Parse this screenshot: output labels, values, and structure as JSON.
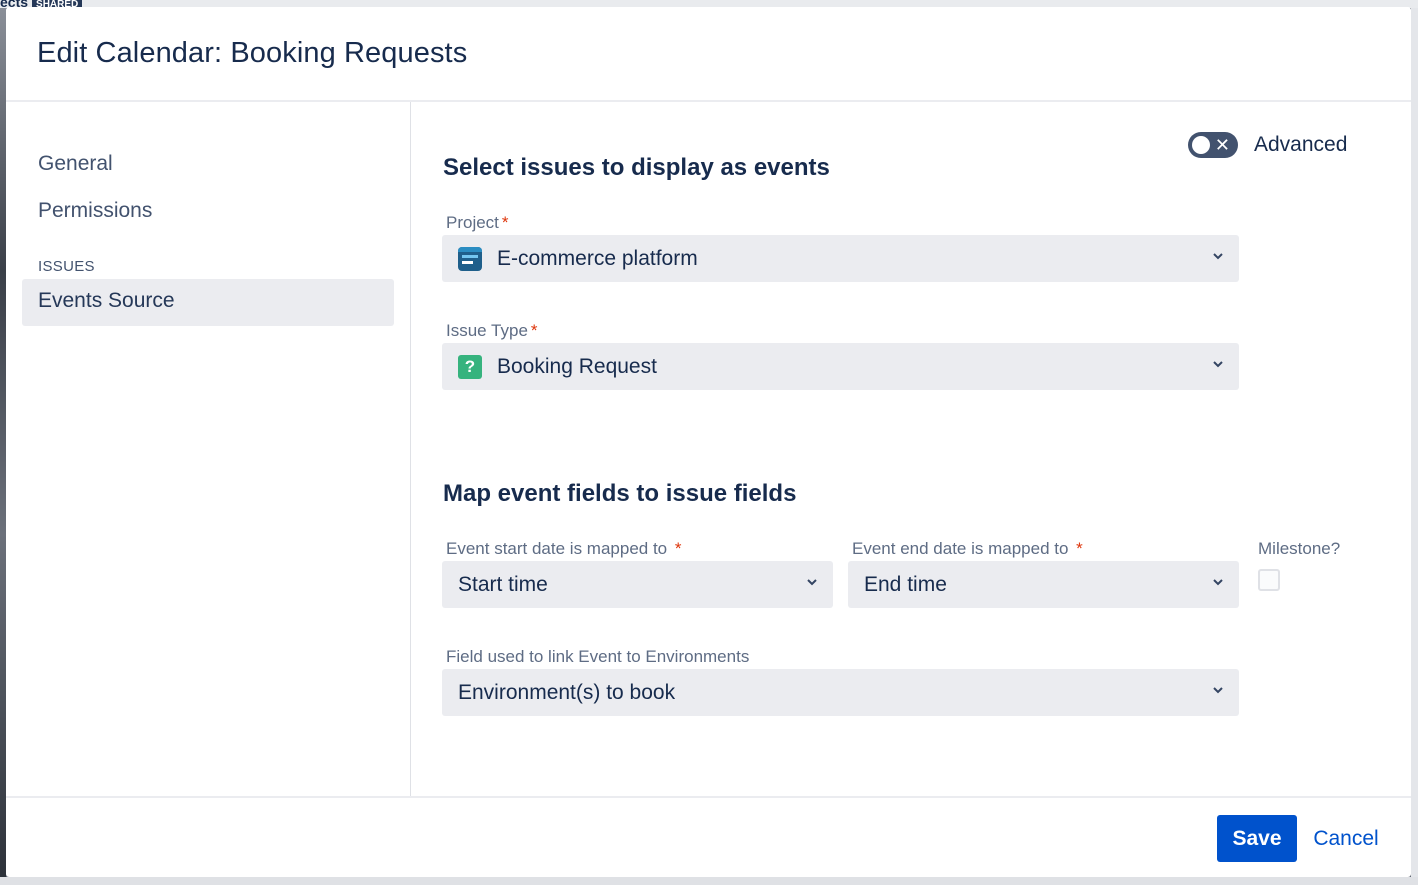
{
  "backdrop": {
    "partial_text": "ects",
    "tag": "SHARED"
  },
  "modal": {
    "title": "Edit Calendar: Booking Requests"
  },
  "sidebar": {
    "items": [
      {
        "label": "General"
      },
      {
        "label": "Permissions"
      }
    ],
    "section_label": "ISSUES",
    "section_items": [
      {
        "label": "Events Source",
        "active": true
      }
    ]
  },
  "advanced_toggle": {
    "label": "Advanced",
    "checked": false
  },
  "issues_section": {
    "title": "Select issues to display as events",
    "project": {
      "label": "Project",
      "required_mark": "*",
      "value": "E-commerce platform",
      "icon": "project-icon"
    },
    "issue_type": {
      "label": "Issue Type",
      "required_mark": "*",
      "value": "Booking Request",
      "icon": "question-mark-icon",
      "icon_glyph": "?"
    }
  },
  "mapping_section": {
    "title": "Map event fields to issue fields",
    "start_date": {
      "label": "Event start date is mapped to",
      "required_mark": "*",
      "value": "Start time"
    },
    "end_date": {
      "label": "Event end date is mapped to",
      "required_mark": "*",
      "value": "End time"
    },
    "milestone": {
      "label": "Milestone?",
      "checked": false
    },
    "environment_field": {
      "label": "Field used to link Event to Environments",
      "value": "Environment(s) to book"
    }
  },
  "footer": {
    "save_label": "Save",
    "cancel_label": "Cancel"
  },
  "colors": {
    "primary": "#0052cc",
    "required": "#de350b",
    "select_bg": "#ebecf0",
    "issue_type_icon": "#36b37e"
  }
}
